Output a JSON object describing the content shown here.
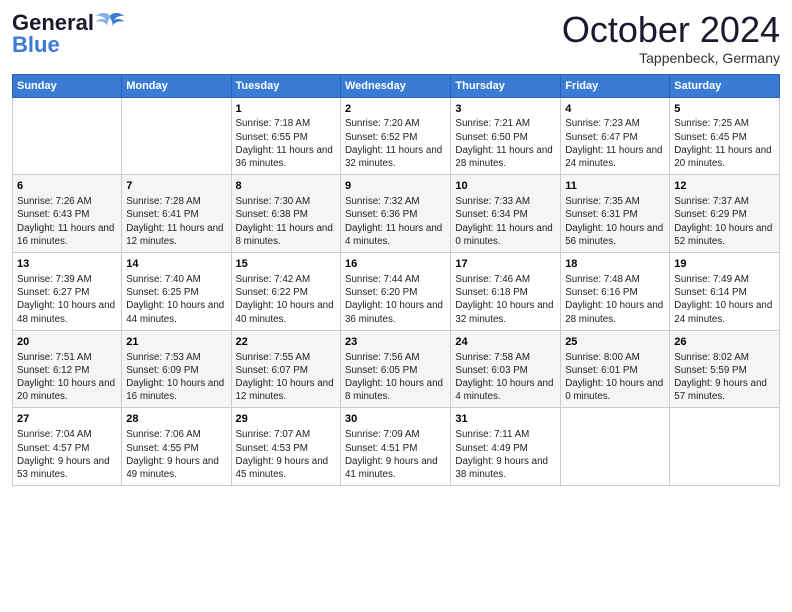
{
  "header": {
    "logo_general": "General",
    "logo_blue": "Blue",
    "month_title": "October 2024",
    "location": "Tappenbeck, Germany"
  },
  "weekdays": [
    "Sunday",
    "Monday",
    "Tuesday",
    "Wednesday",
    "Thursday",
    "Friday",
    "Saturday"
  ],
  "weeks": [
    [
      {
        "day": "",
        "sunrise": "",
        "sunset": "",
        "daylight": ""
      },
      {
        "day": "",
        "sunrise": "",
        "sunset": "",
        "daylight": ""
      },
      {
        "day": "1",
        "sunrise": "Sunrise: 7:18 AM",
        "sunset": "Sunset: 6:55 PM",
        "daylight": "Daylight: 11 hours and 36 minutes."
      },
      {
        "day": "2",
        "sunrise": "Sunrise: 7:20 AM",
        "sunset": "Sunset: 6:52 PM",
        "daylight": "Daylight: 11 hours and 32 minutes."
      },
      {
        "day": "3",
        "sunrise": "Sunrise: 7:21 AM",
        "sunset": "Sunset: 6:50 PM",
        "daylight": "Daylight: 11 hours and 28 minutes."
      },
      {
        "day": "4",
        "sunrise": "Sunrise: 7:23 AM",
        "sunset": "Sunset: 6:47 PM",
        "daylight": "Daylight: 11 hours and 24 minutes."
      },
      {
        "day": "5",
        "sunrise": "Sunrise: 7:25 AM",
        "sunset": "Sunset: 6:45 PM",
        "daylight": "Daylight: 11 hours and 20 minutes."
      }
    ],
    [
      {
        "day": "6",
        "sunrise": "Sunrise: 7:26 AM",
        "sunset": "Sunset: 6:43 PM",
        "daylight": "Daylight: 11 hours and 16 minutes."
      },
      {
        "day": "7",
        "sunrise": "Sunrise: 7:28 AM",
        "sunset": "Sunset: 6:41 PM",
        "daylight": "Daylight: 11 hours and 12 minutes."
      },
      {
        "day": "8",
        "sunrise": "Sunrise: 7:30 AM",
        "sunset": "Sunset: 6:38 PM",
        "daylight": "Daylight: 11 hours and 8 minutes."
      },
      {
        "day": "9",
        "sunrise": "Sunrise: 7:32 AM",
        "sunset": "Sunset: 6:36 PM",
        "daylight": "Daylight: 11 hours and 4 minutes."
      },
      {
        "day": "10",
        "sunrise": "Sunrise: 7:33 AM",
        "sunset": "Sunset: 6:34 PM",
        "daylight": "Daylight: 11 hours and 0 minutes."
      },
      {
        "day": "11",
        "sunrise": "Sunrise: 7:35 AM",
        "sunset": "Sunset: 6:31 PM",
        "daylight": "Daylight: 10 hours and 56 minutes."
      },
      {
        "day": "12",
        "sunrise": "Sunrise: 7:37 AM",
        "sunset": "Sunset: 6:29 PM",
        "daylight": "Daylight: 10 hours and 52 minutes."
      }
    ],
    [
      {
        "day": "13",
        "sunrise": "Sunrise: 7:39 AM",
        "sunset": "Sunset: 6:27 PM",
        "daylight": "Daylight: 10 hours and 48 minutes."
      },
      {
        "day": "14",
        "sunrise": "Sunrise: 7:40 AM",
        "sunset": "Sunset: 6:25 PM",
        "daylight": "Daylight: 10 hours and 44 minutes."
      },
      {
        "day": "15",
        "sunrise": "Sunrise: 7:42 AM",
        "sunset": "Sunset: 6:22 PM",
        "daylight": "Daylight: 10 hours and 40 minutes."
      },
      {
        "day": "16",
        "sunrise": "Sunrise: 7:44 AM",
        "sunset": "Sunset: 6:20 PM",
        "daylight": "Daylight: 10 hours and 36 minutes."
      },
      {
        "day": "17",
        "sunrise": "Sunrise: 7:46 AM",
        "sunset": "Sunset: 6:18 PM",
        "daylight": "Daylight: 10 hours and 32 minutes."
      },
      {
        "day": "18",
        "sunrise": "Sunrise: 7:48 AM",
        "sunset": "Sunset: 6:16 PM",
        "daylight": "Daylight: 10 hours and 28 minutes."
      },
      {
        "day": "19",
        "sunrise": "Sunrise: 7:49 AM",
        "sunset": "Sunset: 6:14 PM",
        "daylight": "Daylight: 10 hours and 24 minutes."
      }
    ],
    [
      {
        "day": "20",
        "sunrise": "Sunrise: 7:51 AM",
        "sunset": "Sunset: 6:12 PM",
        "daylight": "Daylight: 10 hours and 20 minutes."
      },
      {
        "day": "21",
        "sunrise": "Sunrise: 7:53 AM",
        "sunset": "Sunset: 6:09 PM",
        "daylight": "Daylight: 10 hours and 16 minutes."
      },
      {
        "day": "22",
        "sunrise": "Sunrise: 7:55 AM",
        "sunset": "Sunset: 6:07 PM",
        "daylight": "Daylight: 10 hours and 12 minutes."
      },
      {
        "day": "23",
        "sunrise": "Sunrise: 7:56 AM",
        "sunset": "Sunset: 6:05 PM",
        "daylight": "Daylight: 10 hours and 8 minutes."
      },
      {
        "day": "24",
        "sunrise": "Sunrise: 7:58 AM",
        "sunset": "Sunset: 6:03 PM",
        "daylight": "Daylight: 10 hours and 4 minutes."
      },
      {
        "day": "25",
        "sunrise": "Sunrise: 8:00 AM",
        "sunset": "Sunset: 6:01 PM",
        "daylight": "Daylight: 10 hours and 0 minutes."
      },
      {
        "day": "26",
        "sunrise": "Sunrise: 8:02 AM",
        "sunset": "Sunset: 5:59 PM",
        "daylight": "Daylight: 9 hours and 57 minutes."
      }
    ],
    [
      {
        "day": "27",
        "sunrise": "Sunrise: 7:04 AM",
        "sunset": "Sunset: 4:57 PM",
        "daylight": "Daylight: 9 hours and 53 minutes."
      },
      {
        "day": "28",
        "sunrise": "Sunrise: 7:06 AM",
        "sunset": "Sunset: 4:55 PM",
        "daylight": "Daylight: 9 hours and 49 minutes."
      },
      {
        "day": "29",
        "sunrise": "Sunrise: 7:07 AM",
        "sunset": "Sunset: 4:53 PM",
        "daylight": "Daylight: 9 hours and 45 minutes."
      },
      {
        "day": "30",
        "sunrise": "Sunrise: 7:09 AM",
        "sunset": "Sunset: 4:51 PM",
        "daylight": "Daylight: 9 hours and 41 minutes."
      },
      {
        "day": "31",
        "sunrise": "Sunrise: 7:11 AM",
        "sunset": "Sunset: 4:49 PM",
        "daylight": "Daylight: 9 hours and 38 minutes."
      },
      {
        "day": "",
        "sunrise": "",
        "sunset": "",
        "daylight": ""
      },
      {
        "day": "",
        "sunrise": "",
        "sunset": "",
        "daylight": ""
      }
    ]
  ]
}
